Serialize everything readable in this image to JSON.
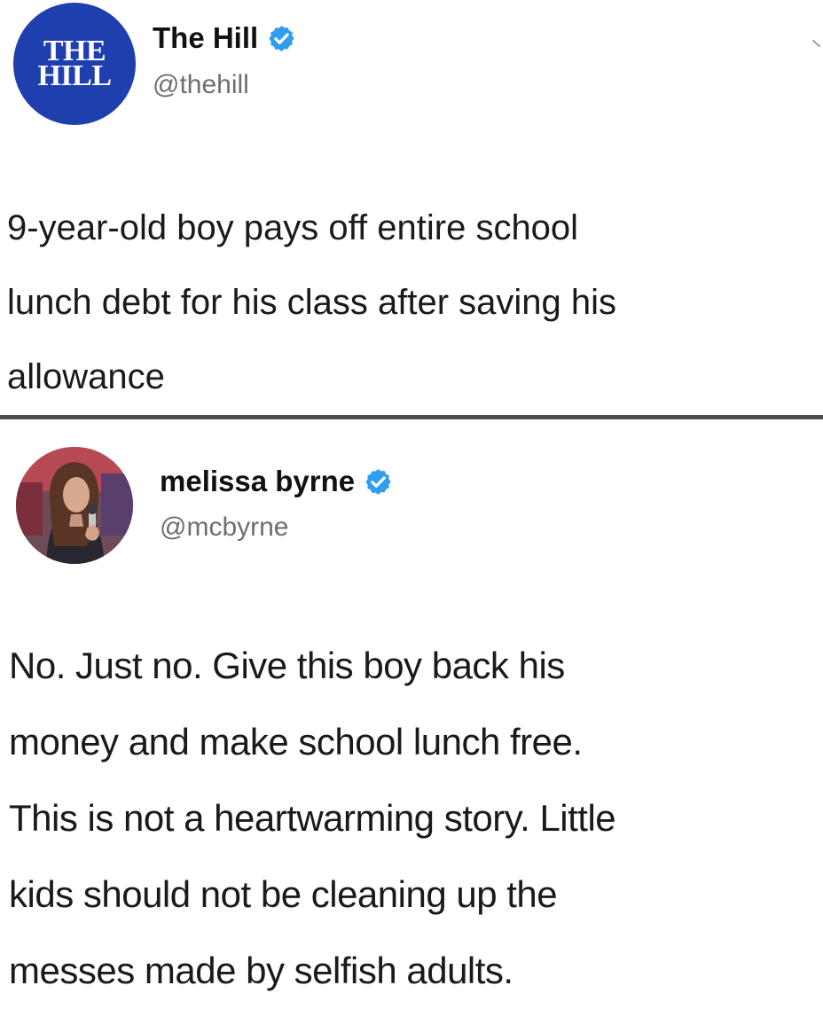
{
  "tweets": [
    {
      "author": {
        "display_name": "The Hill",
        "handle": "@thehill",
        "verified": true,
        "avatar_lines": [
          "THE",
          "HILL"
        ],
        "avatar_color": "#1f3fae"
      },
      "text_lines": [
        "9-year-old boy pays off entire school",
        "lunch debt for his class after saving his",
        "allowance"
      ]
    },
    {
      "author": {
        "display_name": "melissa byrne",
        "handle": "@mcbyrne",
        "verified": true
      },
      "text_lines": [
        "No. Just no. Give this boy back his",
        "money and make school lunch free.",
        "This is not a heartwarming story. Little",
        "kids should not be cleaning up the",
        "messes made by selfish adults."
      ]
    }
  ],
  "icons": {
    "verified": "verified-badge-icon",
    "menu": "chevron-down-icon"
  },
  "colors": {
    "verified_blue": "#2f9df0",
    "handle_gray": "#6b6f73",
    "divider": "#4a4d52"
  }
}
